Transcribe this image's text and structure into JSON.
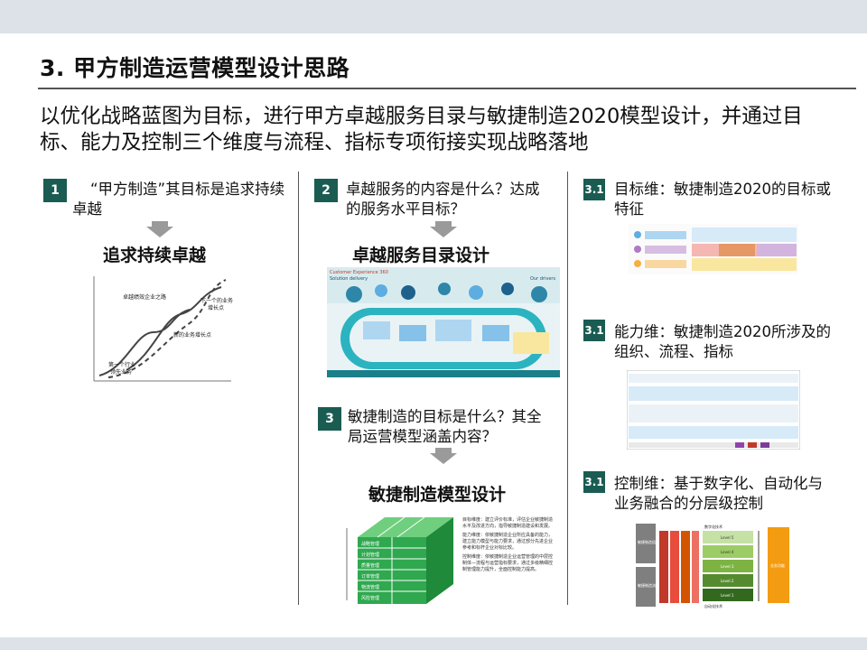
{
  "header": {
    "title": "3. 甲方制造运营模型设计思路"
  },
  "intro": {
    "text": "以优化战略蓝图为目标，进行甲方卓越服务目录与敏捷制造2020模型设计，并通过目标、能力及控制三个维度与流程、指标专项衔接实现战略落地"
  },
  "col1": {
    "badge": "1",
    "question": "“甲方制造”其目标是追求持续卓越",
    "heading": "追求持续卓越",
    "curve_labels": {
      "top": "卓越绩效企业之路",
      "next": "下一个的业务",
      "next2": "增长点",
      "new": "新的业务增长点",
      "first": "第一个行业",
      "first2": "领先业务"
    }
  },
  "col2": {
    "badge": "2",
    "question": "卓越服务的内容是什么？达成的服务水平目标？",
    "heading": "卓越服务目录设计",
    "img_label_left": "Customer Experience 360",
    "img_label_left2": "Solution delivery",
    "img_label_right": "Our drivers",
    "badge3": "3",
    "question3": "敏捷制造的目标是什么？其全局运营模型涵盖内容？",
    "heading3": "敏捷制造模型设计",
    "cube_rows": [
      "战略管理",
      "计划管理",
      "质量管理",
      "订单管理",
      "物流管理",
      "风险管理"
    ],
    "bullets": [
      "目标维度：建立评价标准，评估企业敏捷制造水平及改进方向，指导敏捷制造建设和发展。",
      "能力维度：依敏捷制造企业所应具备的能力，建立能力模型与能力要求，通过部分先进企业参考和标杆企业对标比较。",
      "控制维度：依敏捷制造企业运营管理的中层控制体—流程与运营指标要求，通过多级精细控制管理能力提升，全面控制能力提高。"
    ]
  },
  "col3": {
    "items": [
      {
        "badge": "3.1",
        "text": "目标维：敏捷制造2020的目标或特征"
      },
      {
        "badge": "3.1",
        "text": "能力维：敏捷制造2020所涉及的组织、流程、指标"
      },
      {
        "badge": "3.1",
        "text": "控制维：基于数字化、自动化与业务融合的分层级控制"
      }
    ],
    "ctrl_labels": {
      "top": "数字化技术",
      "bottom": "自动化技术",
      "left1": "敏捷制造组织",
      "left2": "敏捷制造流程",
      "right": "业务功能",
      "levels": [
        "Level 5",
        "Level 4",
        "Level 3",
        "Level 2",
        "Level 1"
      ]
    }
  },
  "colors": {
    "badge": "#1a5c52",
    "bar": "#dde1e8",
    "cube_green": "#2fa84f",
    "arrow_gray": "#9a9a9a"
  }
}
